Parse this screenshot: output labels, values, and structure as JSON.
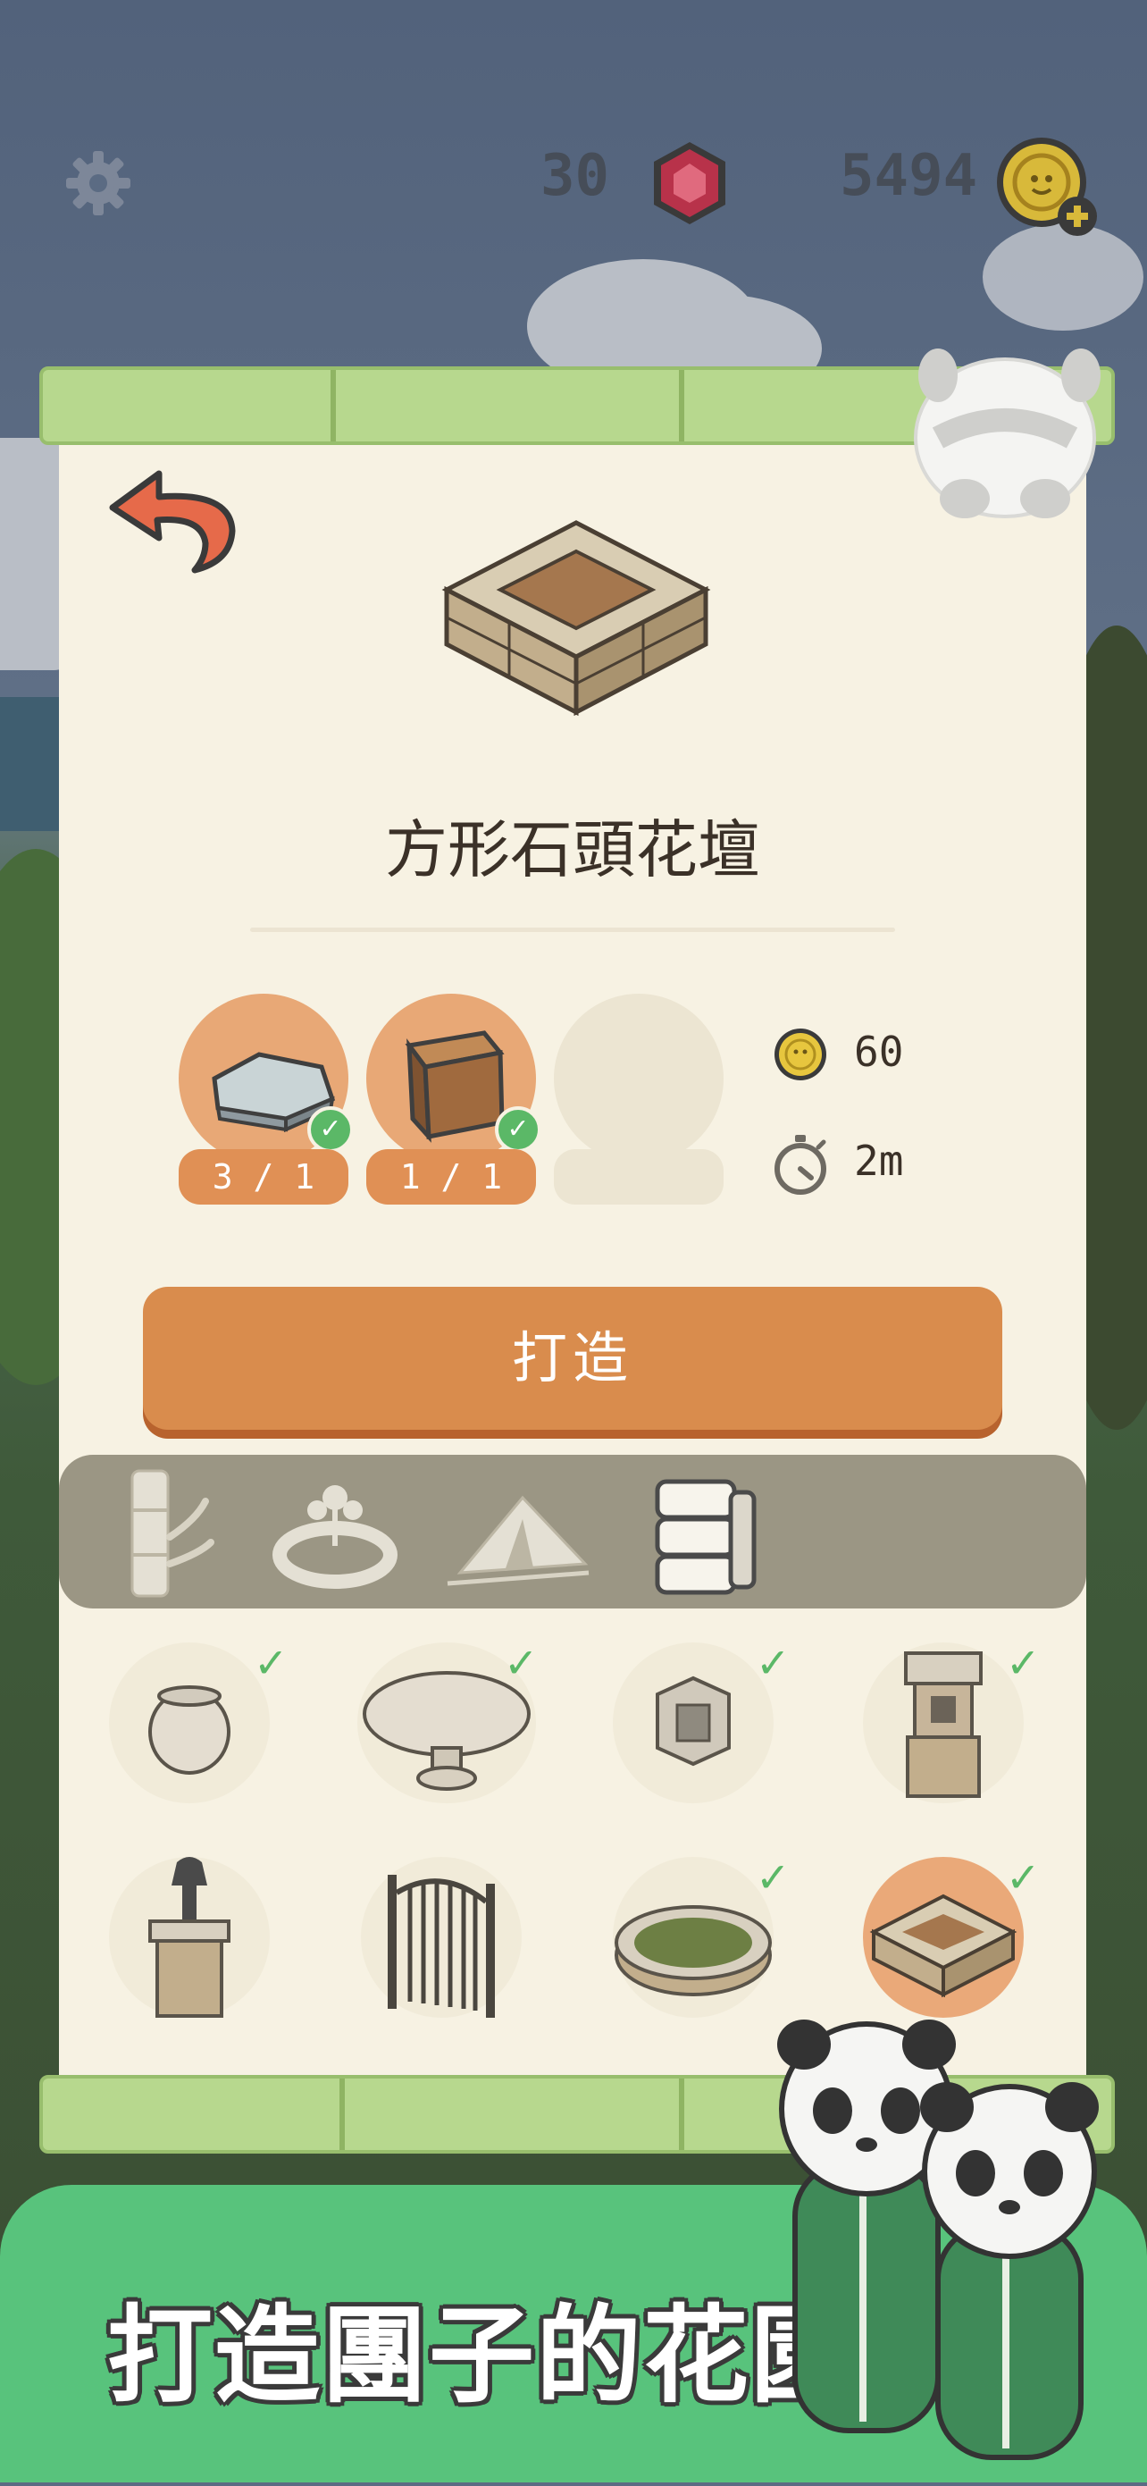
{
  "header": {
    "gems": "30",
    "coins": "5494"
  },
  "item": {
    "name": "方形石頭花壇"
  },
  "materials": [
    {
      "count": "3 / 1",
      "have": true
    },
    {
      "count": "1 / 1",
      "have": true
    },
    {
      "count": "",
      "have": false
    }
  ],
  "cost": {
    "coins": "60",
    "time": "2m"
  },
  "craft_button": "打造",
  "categories": [
    "bamboo-icon",
    "flowerbed-fence-icon",
    "tent-icon",
    "stone-blocks-icon"
  ],
  "selected_category": 3,
  "items": [
    {
      "name": "stone-jar",
      "owned": true
    },
    {
      "name": "stone-table",
      "owned": true
    },
    {
      "name": "stone-lantern-small",
      "owned": true
    },
    {
      "name": "stone-lantern-tall",
      "owned": true
    },
    {
      "name": "brick-lamp-post",
      "owned": false
    },
    {
      "name": "iron-gate",
      "owned": false
    },
    {
      "name": "round-stone-flowerbed",
      "owned": true
    },
    {
      "name": "square-stone-flowerbed",
      "owned": true,
      "selected": true
    }
  ],
  "banner": "打造團子的花園",
  "colors": {
    "accent": "#d98c4d",
    "panel": "#f7f2e3",
    "banner": "#58c37c",
    "check": "#5bb867"
  }
}
